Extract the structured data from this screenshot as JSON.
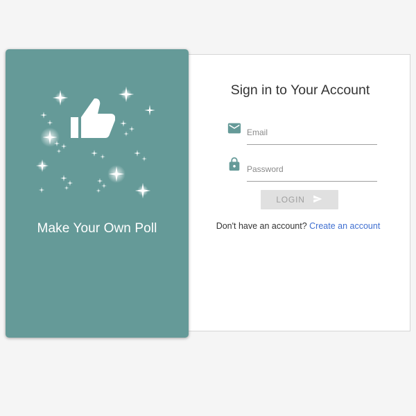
{
  "brand": {
    "title": "Make Your Own Poll",
    "panel_color": "#659a98",
    "illustration_icon": "thumbs-up-icon",
    "decoration": "sparkles"
  },
  "form": {
    "title": "Sign in to Your Account",
    "email": {
      "icon": "mail-icon",
      "placeholder": "Email",
      "value": ""
    },
    "password": {
      "icon": "lock-icon",
      "placeholder": "Password",
      "value": ""
    },
    "login": {
      "label": "LOGIN",
      "icon": "send-icon",
      "state": "disabled"
    },
    "signup": {
      "prompt": "Don't have an account?",
      "link_label": "Create an account"
    }
  },
  "colors": {
    "accent": "#659a98",
    "link": "#3f6fd1",
    "page_background": "#f5f5f5"
  }
}
